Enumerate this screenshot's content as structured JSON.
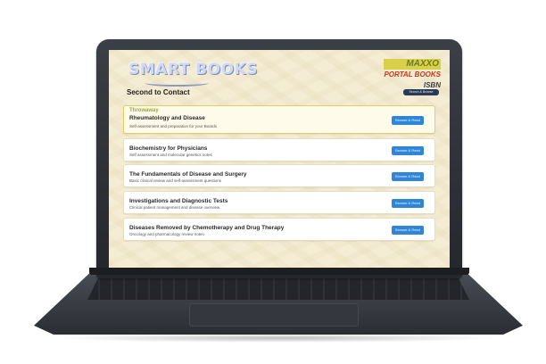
{
  "app": {
    "logo": "SMART BOOKS",
    "brand_lines": [
      "MAXXO",
      "PORTAL BOOKS",
      "ISBN"
    ]
  },
  "header": {
    "section_title": "Second to Contact",
    "action_button": "Search & Browse"
  },
  "cards": [
    {
      "label": "Throwaway",
      "title": "Rheumatology and Disease",
      "subtitle": "Self-assessment and preparation for your Boards",
      "button": "Browse & Read"
    },
    {
      "title": "Biochemistry for Physicians",
      "subtitle": "Self assessment and molecular genetics notes",
      "button": "Browse & Read"
    },
    {
      "title": "The Fundamentals of Disease and Surgery",
      "subtitle": "Basic clinical review and self-assessment questions",
      "button": "Browse & Read"
    },
    {
      "title": "Investigations and Diagnostic Tests",
      "subtitle": "Clinical patient management and disease overview",
      "button": "Browse & Read"
    },
    {
      "title": "Diseases Removed by Chemotherapy and Drug Therapy",
      "subtitle": "Oncology and pharmacology review notes",
      "button": "Browse & Read"
    }
  ]
}
